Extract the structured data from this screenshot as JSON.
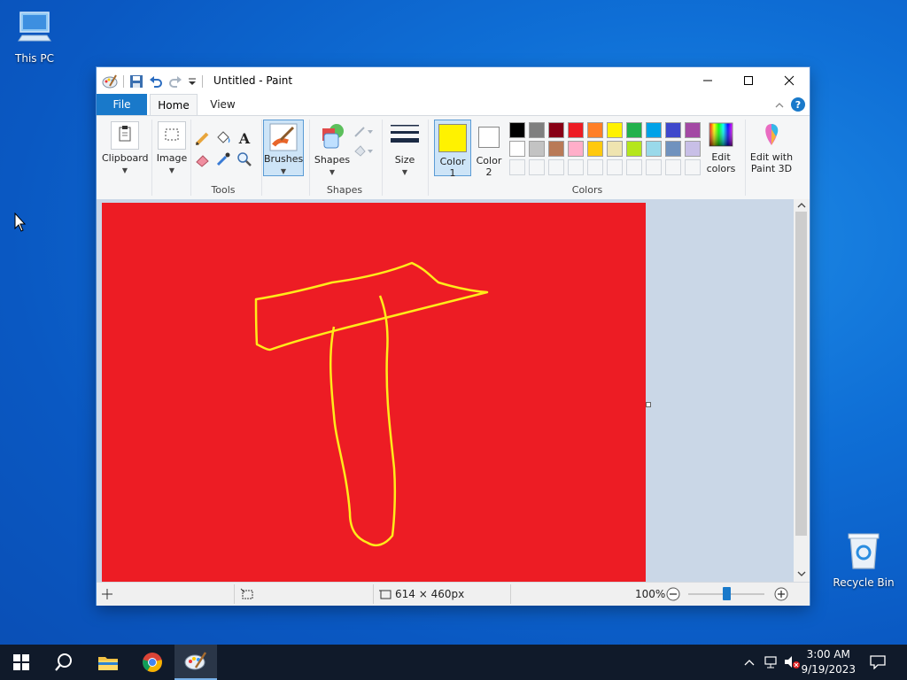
{
  "desktop": {
    "icons": [
      {
        "label": "This PC"
      },
      {
        "label": "Recycle Bin"
      }
    ]
  },
  "window": {
    "title": "Untitled - Paint",
    "tabs": [
      {
        "label": "File"
      },
      {
        "label": "Home"
      },
      {
        "label": "View"
      }
    ],
    "groups": {
      "clipboard": "Clipboard",
      "image": "Image",
      "tools": "Tools",
      "brushes": "Brushes",
      "shapes_button": "Shapes",
      "shapes_group": "Shapes",
      "size": "Size",
      "color1_line1": "Color",
      "color1_line2": "1",
      "color2_line1": "Color",
      "color2_line2": "2",
      "colors_group": "Colors",
      "edit_colors_line1": "Edit",
      "edit_colors_line2": "colors",
      "edit_paint3d_line1": "Edit with",
      "edit_paint3d_line2": "Paint 3D"
    },
    "palette_row1": [
      "#000000",
      "#7f7f7f",
      "#880015",
      "#ed1c24",
      "#ff7f27",
      "#fff200",
      "#22b14c",
      "#00a2e8",
      "#3f48cc",
      "#a349a4"
    ],
    "palette_row2": [
      "#ffffff",
      "#c3c3c3",
      "#b97a57",
      "#ffaec9",
      "#ffc90e",
      "#efe4b0",
      "#b5e61d",
      "#99d9ea",
      "#7092be",
      "#c8bfe7"
    ],
    "color1": "#fff200",
    "color2": "#ffffff",
    "canvas_color": "#ed1c24",
    "status": {
      "dimensions": "614 × 460px",
      "zoom": "100%",
      "zoom_level_fraction": 0.5
    }
  },
  "taskbar": {
    "time": "3:00 AM",
    "date": "9/19/2023"
  }
}
